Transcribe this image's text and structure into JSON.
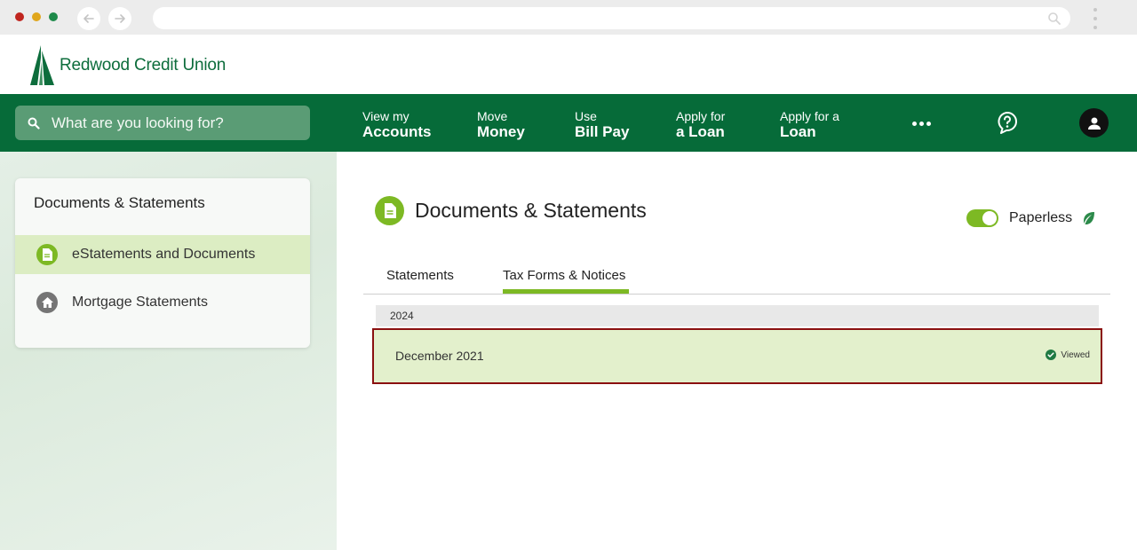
{
  "browser": {
    "back_icon": "arrow-left-icon",
    "forward_icon": "arrow-right-icon",
    "menu_icon": "kebab-icon"
  },
  "brand": {
    "name": "Redwood Credit Union",
    "color": "#0d6d3c",
    "nav_color": "#066b39",
    "accent": "#7db924"
  },
  "search": {
    "placeholder": "What are you looking for?"
  },
  "nav": {
    "items": [
      {
        "line1": "View my",
        "line2": "Accounts"
      },
      {
        "line1": "Move",
        "line2": "Money"
      },
      {
        "line1": "Use",
        "line2": "Bill Pay"
      },
      {
        "line1": "Apply for",
        "line2": "a Loan"
      },
      {
        "line1": "Apply for a",
        "line2": "Loan"
      }
    ]
  },
  "sidebar": {
    "title": "Documents & Statements",
    "items": [
      {
        "label": "eStatements and Documents",
        "icon": "document-icon",
        "active": true
      },
      {
        "label": "Mortgage Statements",
        "icon": "home-icon",
        "active": false
      }
    ]
  },
  "main": {
    "title": "Documents & Statements",
    "paperless_label": "Paperless",
    "paperless_on": true,
    "tabs": [
      {
        "label": "Statements",
        "active": false
      },
      {
        "label": "Tax Forms & Notices",
        "active": true
      }
    ],
    "year": "2024",
    "rows": [
      {
        "label": "December 2021",
        "status": "Viewed"
      }
    ]
  }
}
